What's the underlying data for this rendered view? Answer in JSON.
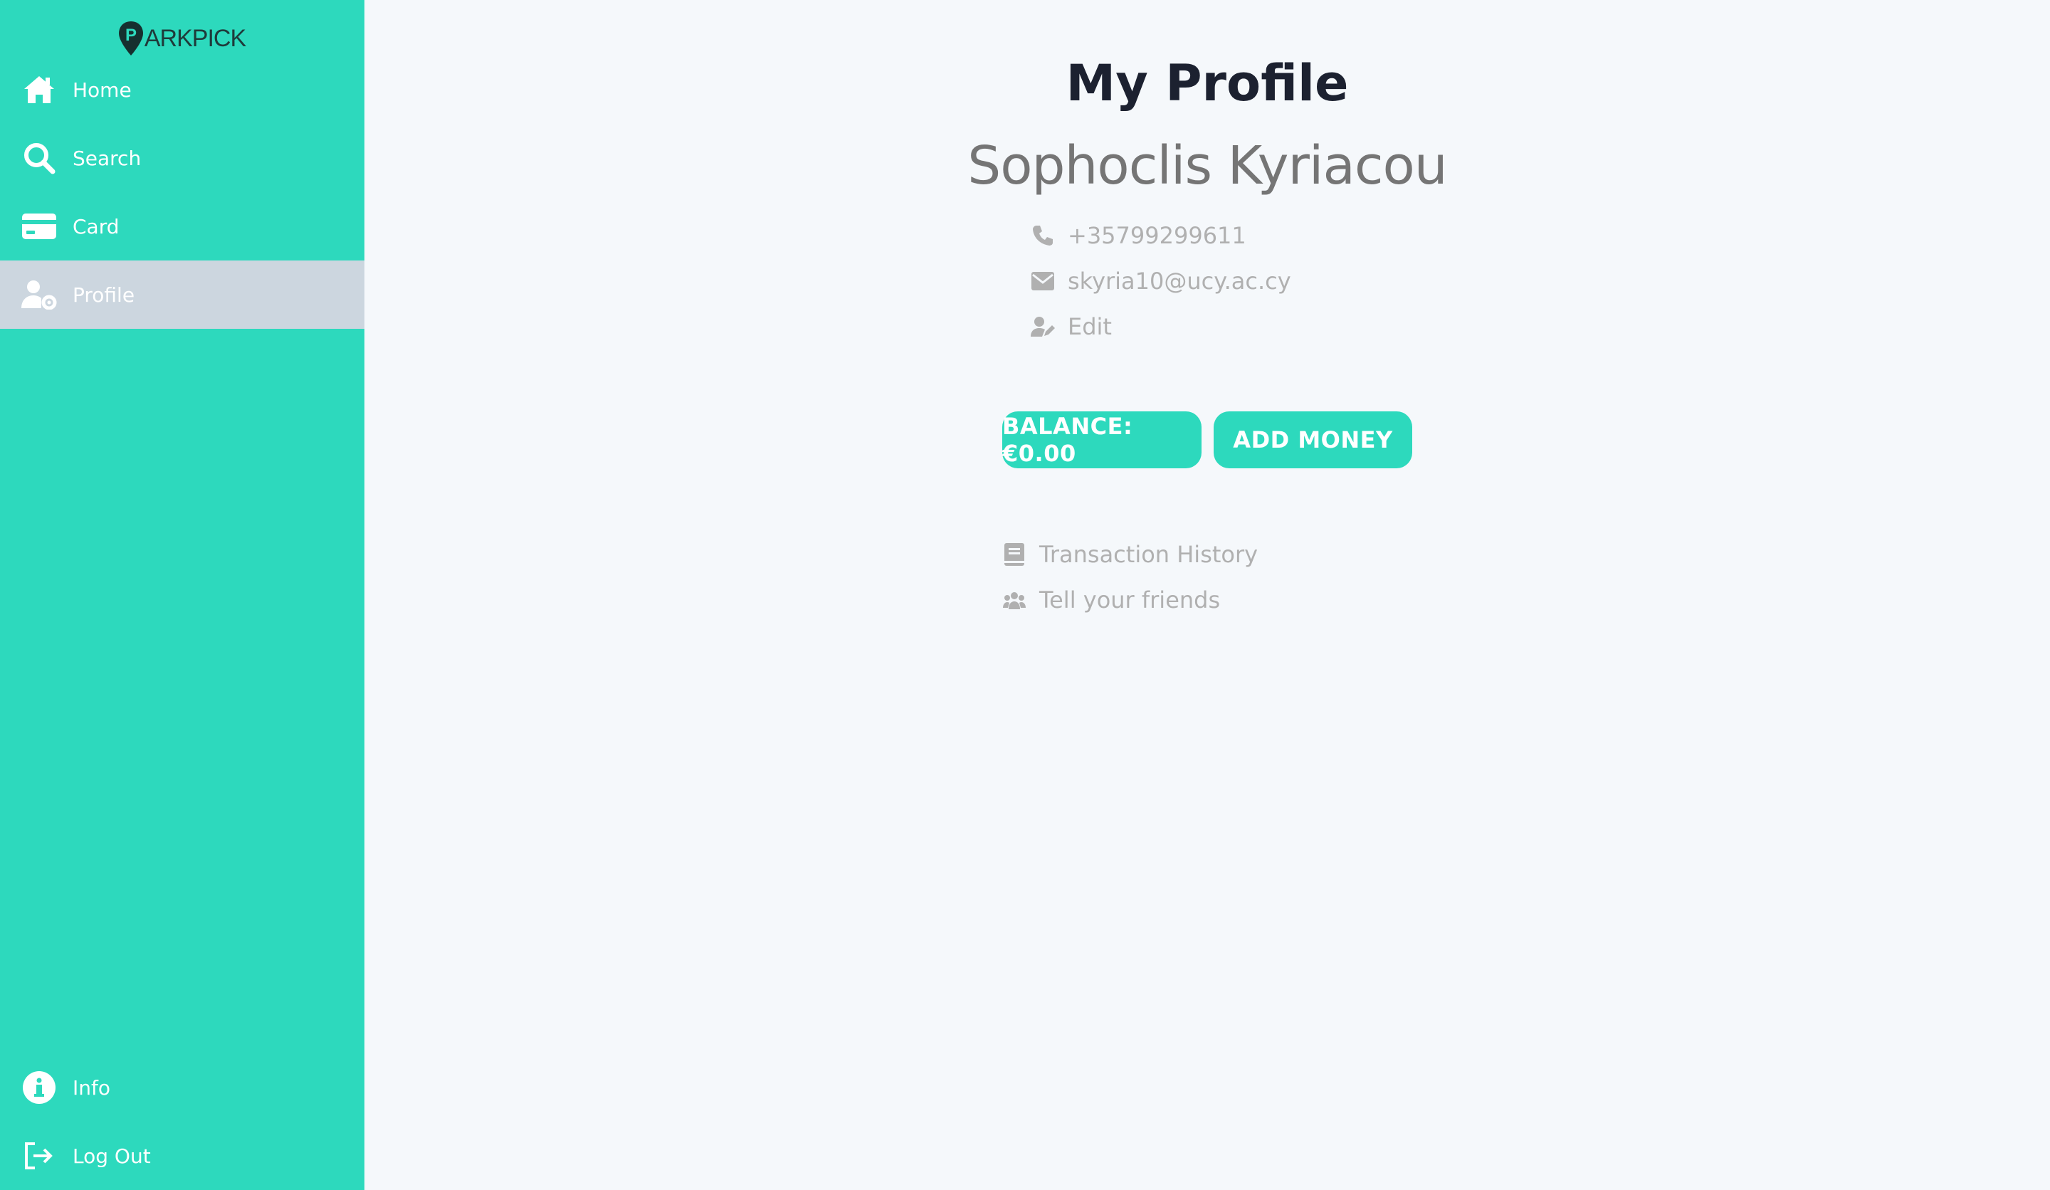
{
  "app": {
    "logo_initial": "P",
    "logo_rest": "ARKPICK",
    "brand_color": "#2dd9bd"
  },
  "sidebar": {
    "items": [
      {
        "label": "Home",
        "icon": "home-icon"
      },
      {
        "label": "Search",
        "icon": "search-icon"
      },
      {
        "label": "Card",
        "icon": "credit-card-icon"
      },
      {
        "label": "Profile",
        "icon": "user-cog-icon",
        "active": true
      }
    ],
    "bottom_items": [
      {
        "label": "Info",
        "icon": "info-icon"
      },
      {
        "label": "Log Out",
        "icon": "logout-icon"
      }
    ]
  },
  "profile": {
    "title": "My Profile",
    "name": "Sophoclis Kyriacou",
    "phone": "+35799299611",
    "email": "skyria10@ucy.ac.cy",
    "edit_label": "Edit",
    "balance_label": "BALANCE: €0.00",
    "add_money_label": "ADD MONEY",
    "transaction_history_label": "Transaction History",
    "tell_friends_label": "Tell your friends"
  }
}
